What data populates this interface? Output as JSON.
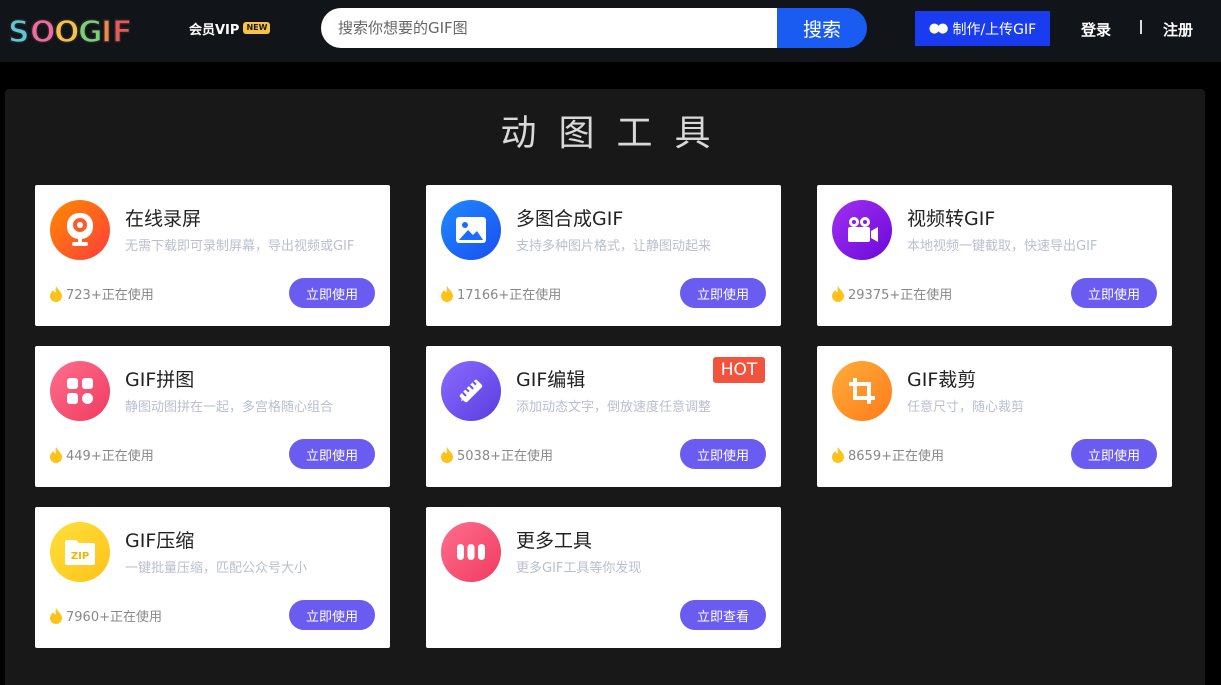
{
  "header": {
    "vip_label": "会员VIP",
    "vip_badge": "NEW",
    "search_placeholder": "搜索你想要的GIF图",
    "search_button": "搜索",
    "make_button": "制作/上传GIF",
    "login": "登录",
    "register": "注册"
  },
  "page": {
    "title": "动图工具"
  },
  "colors": {
    "accent_button": "#6a5cf0",
    "search_button": "#1a5cf2",
    "hot_badge": "#f2533d"
  },
  "tools": [
    {
      "title": "在线录屏",
      "desc": "无需下载即可录制屏幕，导出视频或GIF",
      "usage": "723+正在使用",
      "button": "立即使用",
      "icon": "webcam-icon"
    },
    {
      "title": "多图合成GIF",
      "desc": "支持多种图片格式，让静图动起来",
      "usage": "17166+正在使用",
      "button": "立即使用",
      "icon": "image-icon"
    },
    {
      "title": "视频转GIF",
      "desc": "本地视频一键截取，快速导出GIF",
      "usage": "29375+正在使用",
      "button": "立即使用",
      "icon": "video-camera-icon"
    },
    {
      "title": "GIF拼图",
      "desc": "静图动图拼在一起，多宫格随心组合",
      "usage": "449+正在使用",
      "button": "立即使用",
      "icon": "grid-icon"
    },
    {
      "title": "GIF编辑",
      "desc": "添加动态文字，倒放速度任意调整",
      "usage": "5038+正在使用",
      "button": "立即使用",
      "icon": "pencil-ruler-icon",
      "badge": "HOT"
    },
    {
      "title": "GIF裁剪",
      "desc": "任意尺寸，随心裁剪",
      "usage": "8659+正在使用",
      "button": "立即使用",
      "icon": "crop-icon"
    },
    {
      "title": "GIF压缩",
      "desc": "一键批量压缩，匹配公众号大小",
      "usage": "7960+正在使用",
      "button": "立即使用",
      "icon": "zip-folder-icon",
      "icon_text": "ZIP"
    },
    {
      "title": "更多工具",
      "desc": "更多GIF工具等你发现",
      "button": "立即查看",
      "icon": "more-icon"
    }
  ]
}
